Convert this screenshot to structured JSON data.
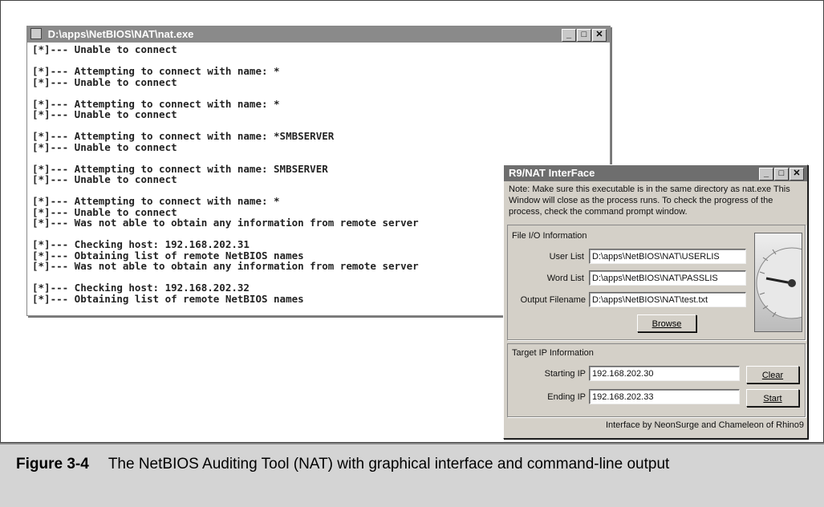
{
  "console": {
    "title": "D:\\apps\\NetBIOS\\NAT\\nat.exe",
    "lines": [
      "[*]--- Unable to connect",
      "",
      "[*]--- Attempting to connect with name: *",
      "[*]--- Unable to connect",
      "",
      "[*]--- Attempting to connect with name: *",
      "[*]--- Unable to connect",
      "",
      "[*]--- Attempting to connect with name: *SMBSERVER",
      "[*]--- Unable to connect",
      "",
      "[*]--- Attempting to connect with name: SMBSERVER",
      "[*]--- Unable to connect",
      "",
      "[*]--- Attempting to connect with name: *",
      "[*]--- Unable to connect",
      "[*]--- Was not able to obtain any information from remote server",
      "",
      "[*]--- Checking host: 192.168.202.31",
      "[*]--- Obtaining list of remote NetBIOS names",
      "[*]--- Was not able to obtain any information from remote server",
      "",
      "[*]--- Checking host: 192.168.202.32",
      "[*]--- Obtaining list of remote NetBIOS names"
    ]
  },
  "dialog": {
    "title": "R9/NAT InterFace",
    "note": "Note: Make sure this executable is in the same directory as nat.exe This Window will close as the process runs. To check the progress of the process, check the command prompt window.",
    "file_group_label": "File I/O Information",
    "user_list_label": "User List",
    "user_list_value": "D:\\apps\\NetBIOS\\NAT\\USERLIS",
    "word_list_label": "Word List",
    "word_list_value": "D:\\apps\\NetBIOS\\NAT\\PASSLIS",
    "output_label": "Output Filename",
    "output_value": "D:\\apps\\NetBIOS\\NAT\\test.txt",
    "browse_label": "Browse",
    "target_group_label": "Target IP Information",
    "starting_ip_label": "Starting IP",
    "starting_ip_value": "192.168.202.30",
    "ending_ip_label": "Ending IP",
    "ending_ip_value": "192.168.202.33",
    "clear_label": "Clear",
    "start_label": "Start",
    "status": "Interface by NeonSurge and Chameleon of Rhino9"
  },
  "caption": {
    "figure": "Figure 3-4",
    "text": "The NetBIOS Auditing Tool (NAT) with graphical interface and command-line output"
  }
}
